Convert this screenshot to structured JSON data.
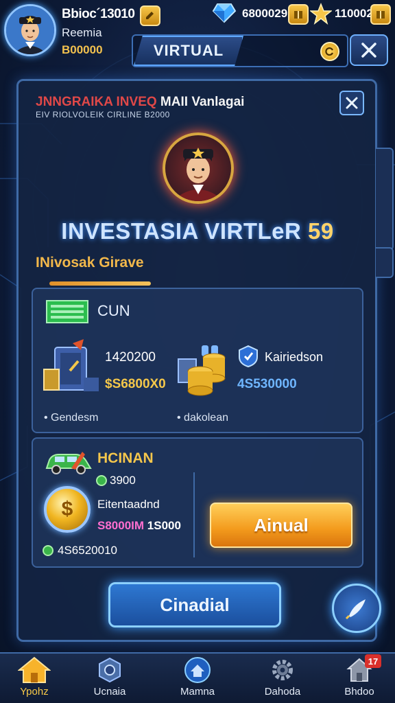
{
  "header": {
    "player_name": "Bbioc´13010",
    "player_sub": "Reemia",
    "player_coins": "B00000",
    "resource_1": "6800029",
    "resource_2": "110002",
    "virtual_tab": "VIRTUAL"
  },
  "panel": {
    "title_red": "JNNGRAIKA INVEQ",
    "title_white": " MAII Vanlagai",
    "subtitle": "EIV RIOLVOLEIK CIRLINE B2000",
    "hero_title": "INVESTASIA VIRTLeR",
    "hero_number": "59",
    "hero_sub": "INivosak Girave"
  },
  "card1": {
    "title": "CUN",
    "item1_value": "1420200",
    "item1_price": "$S6800X0",
    "item2_label": "Kairiedson",
    "item2_price": "4S530000",
    "foot1": "Gendesm",
    "foot2": "dakolean"
  },
  "card2": {
    "title": "HCINAN",
    "stat": "3900",
    "label": "Eitentaadnd",
    "price_pink": "S8000IM",
    "price_white": "1S000",
    "bottom_value": "4S6520010",
    "annual_button": "Ainual"
  },
  "main_button": "Cinadial",
  "nav": [
    {
      "label": "Ypohz"
    },
    {
      "label": "Ucnaia"
    },
    {
      "label": "Mamna"
    },
    {
      "label": "Dahoda"
    },
    {
      "label": "Bhdoo"
    }
  ],
  "nav_badge": "17",
  "colors": {
    "accent_gold": "#f5c84a",
    "accent_blue": "#3f9cff",
    "orange_button": "#f39a1c",
    "panel_bg": "#14243f"
  }
}
